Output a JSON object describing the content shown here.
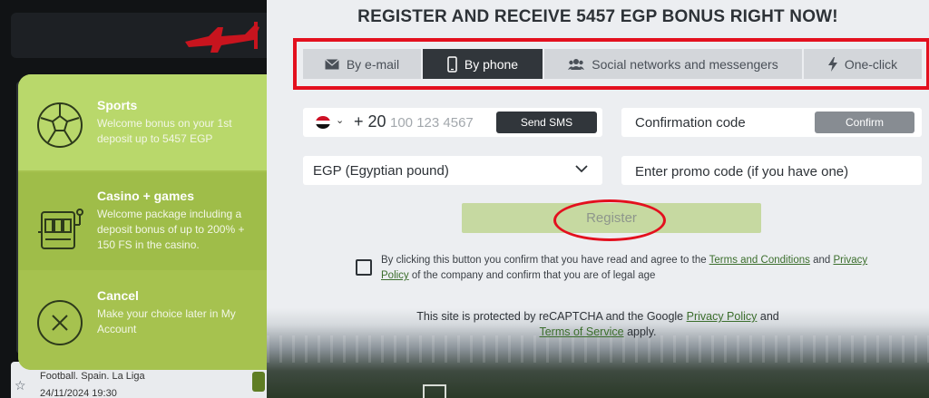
{
  "heading": "REGISTER AND RECEIVE 5457 EGP BONUS RIGHT NOW!",
  "tabs": [
    {
      "label": "By e-mail",
      "icon": "envelope-icon"
    },
    {
      "label": "By phone",
      "icon": "phone-icon",
      "active": true
    },
    {
      "label": "Social networks and messengers",
      "icon": "people-icon"
    },
    {
      "label": "One-click",
      "icon": "lightning-icon"
    }
  ],
  "phone": {
    "dial_code": "+ 20",
    "placeholder": "100 123 4567",
    "send_sms": "Send SMS",
    "country_flag": "egypt-flag-icon"
  },
  "confirmation": {
    "label": "Confirmation code",
    "button": "Confirm"
  },
  "currency": {
    "selected": "EGP (Egyptian pound)"
  },
  "promo": {
    "placeholder": "Enter promo code (if you have one)"
  },
  "register_button": "Register",
  "agreement": {
    "text_1": "By clicking this button you confirm that you have read and agree to the",
    "terms_link": "Terms and Conditions",
    "text_2": "and",
    "privacy_link": "Privacy Policy",
    "text_3": "of the company and confirm that you are of legal age"
  },
  "captcha": {
    "text_1": "This site is protected by reCAPTCHA and the Google",
    "privacy_link": "Privacy Policy",
    "text_2": "and",
    "terms_link": "Terms of Service",
    "text_3": "apply."
  },
  "bonus_options": {
    "sports": {
      "title": "Sports",
      "desc": "Welcome bonus on your 1st deposit up to 5457 EGP",
      "icon": "soccer-ball-icon"
    },
    "casino": {
      "title": "Casino + games",
      "desc": "Welcome package including a deposit bonus of up to 200% + 150 FS in the casino.",
      "icon": "slot-machine-icon"
    },
    "cancel": {
      "title": "Cancel",
      "desc": "Make your choice later in My Account",
      "icon": "close-circle-icon"
    }
  },
  "background_event": {
    "league": "Football. Spain. La Liga",
    "datetime": "24/11/2024 19:30"
  },
  "colors": {
    "highlight_red": "#e3101e",
    "active_tab": "#31363b",
    "bonus_green": "#a6c24f",
    "register_green": "#c6d9a1",
    "link_green": "#3b6e2c"
  }
}
